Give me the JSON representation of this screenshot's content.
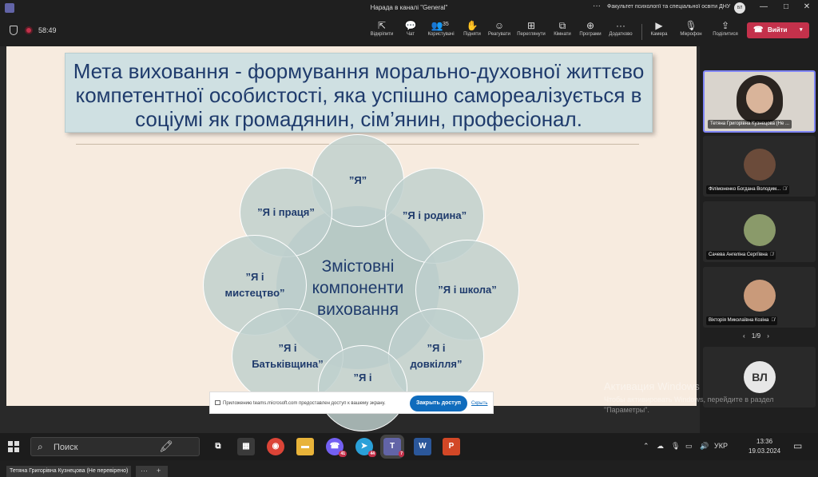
{
  "window": {
    "title": "Нарада в каналі \"General\"",
    "more": "···",
    "org": "Факультет психології та спеціальної освіти ДНУ",
    "avatar_initials": "ВЛ",
    "controls": [
      "—",
      "□",
      "✕"
    ]
  },
  "toolbar": {
    "timer": "58:49",
    "buttons": [
      {
        "label": "Відкріпити",
        "icon": "unpin-icon",
        "glyph": "⇱"
      },
      {
        "label": "Чат",
        "icon": "chat-icon",
        "glyph": "💬"
      },
      {
        "label": "Користувачі",
        "icon": "people-icon",
        "glyph": "👥",
        "count": "35"
      },
      {
        "label": "Підняти",
        "icon": "raise-hand-icon",
        "glyph": "✋"
      },
      {
        "label": "Реагувати",
        "icon": "react-icon",
        "glyph": "☺"
      },
      {
        "label": "Переглянути",
        "icon": "view-icon",
        "glyph": "⊞"
      },
      {
        "label": "Кімнати",
        "icon": "rooms-icon",
        "glyph": "⧉"
      },
      {
        "label": "Програми",
        "icon": "apps-icon",
        "glyph": "⊕"
      },
      {
        "label": "Додатково",
        "icon": "more-icon",
        "glyph": "···"
      },
      {
        "label": "Камера",
        "icon": "camera-icon",
        "glyph": "▶"
      },
      {
        "label": "Мікрофон",
        "icon": "mic-icon",
        "glyph": "🎙"
      },
      {
        "label": "Поділитися",
        "icon": "share-icon",
        "glyph": "⇪"
      }
    ],
    "leave_label": "Вийти"
  },
  "slide": {
    "title_lines": [
      "Мета виховання - формування морально-духовної життєво",
      "компетентної особистості, яка успішно самореалізується в",
      "соціумі як громадянин, сім’янин, професіонал."
    ],
    "center_lines": [
      "Змістовні",
      "компоненти",
      "виховання"
    ],
    "petals": {
      "ya": "”Я”",
      "pratsia": "”Я і праця”",
      "rodyna": "”Я і родина”",
      "mystetstvo_1": "”Я і",
      "mystetstvo_2": "мистецтво”",
      "shkola": "”Я і школа”",
      "batkivshchyna_1": "”Я і",
      "batkivshchyna_2": "Батьківщина”",
      "dovkillia_1": "”Я і",
      "dovkillia_2": "довкілля”",
      "bottom": "”Я і"
    }
  },
  "share_bar": {
    "message": "Приложению teams.microsoft.com предоставлен доступ к вашему экрану.",
    "stop_label": "Закрыть доступ",
    "hide_label": "Скрыть"
  },
  "presenter_caption": "Тетяна Григорівна Кузнецова (Не перевірено)",
  "caption_more": "···",
  "caption_plus": "+",
  "participants": [
    {
      "name": "Тетяна Григорівна Кузнецова (Не ...",
      "muted": false
    },
    {
      "name": "Філімоненко Богдана Володим...",
      "muted": true
    },
    {
      "name": "Сачева Ангеліна Сергіївна",
      "muted": true
    },
    {
      "name": "Вікторія Миколаївна Козіна",
      "muted": true
    }
  ],
  "pager": {
    "prev": "‹",
    "text": "1/9",
    "next": "›"
  },
  "vl_initials": "ВЛ",
  "mic_off_glyph": "🎙̸",
  "watermark": {
    "line1": "Активация Windows",
    "line2": "Чтобы активировать Windows, перейдите в раздел \"Параметры\"."
  },
  "taskbar": {
    "search_placeholder": "Поиск",
    "apps": [
      {
        "name": "task-view",
        "glyph": "⧉",
        "color": "#1c1c1c"
      },
      {
        "name": "calculator",
        "glyph": "▦",
        "color": "#3a3a3a"
      },
      {
        "name": "chrome",
        "glyph": "◉",
        "color": "#db4437"
      },
      {
        "name": "explorer",
        "glyph": "▬",
        "color": "#e8b339"
      },
      {
        "name": "viber",
        "glyph": "☎",
        "color": "#7360f2",
        "count": "41"
      },
      {
        "name": "telegram",
        "glyph": "➤",
        "color": "#2aa0d8",
        "count": "44"
      },
      {
        "name": "teams",
        "glyph": "T",
        "color": "#6264a7",
        "count": "7"
      },
      {
        "name": "word",
        "glyph": "W",
        "color": "#2b579a"
      },
      {
        "name": "powerpoint",
        "glyph": "P",
        "color": "#d24726"
      }
    ],
    "tray": [
      "⌃",
      "☁",
      "🎙",
      "▭",
      "🔊",
      "УКР"
    ],
    "time": "13:36",
    "date": "19.03.2024"
  }
}
